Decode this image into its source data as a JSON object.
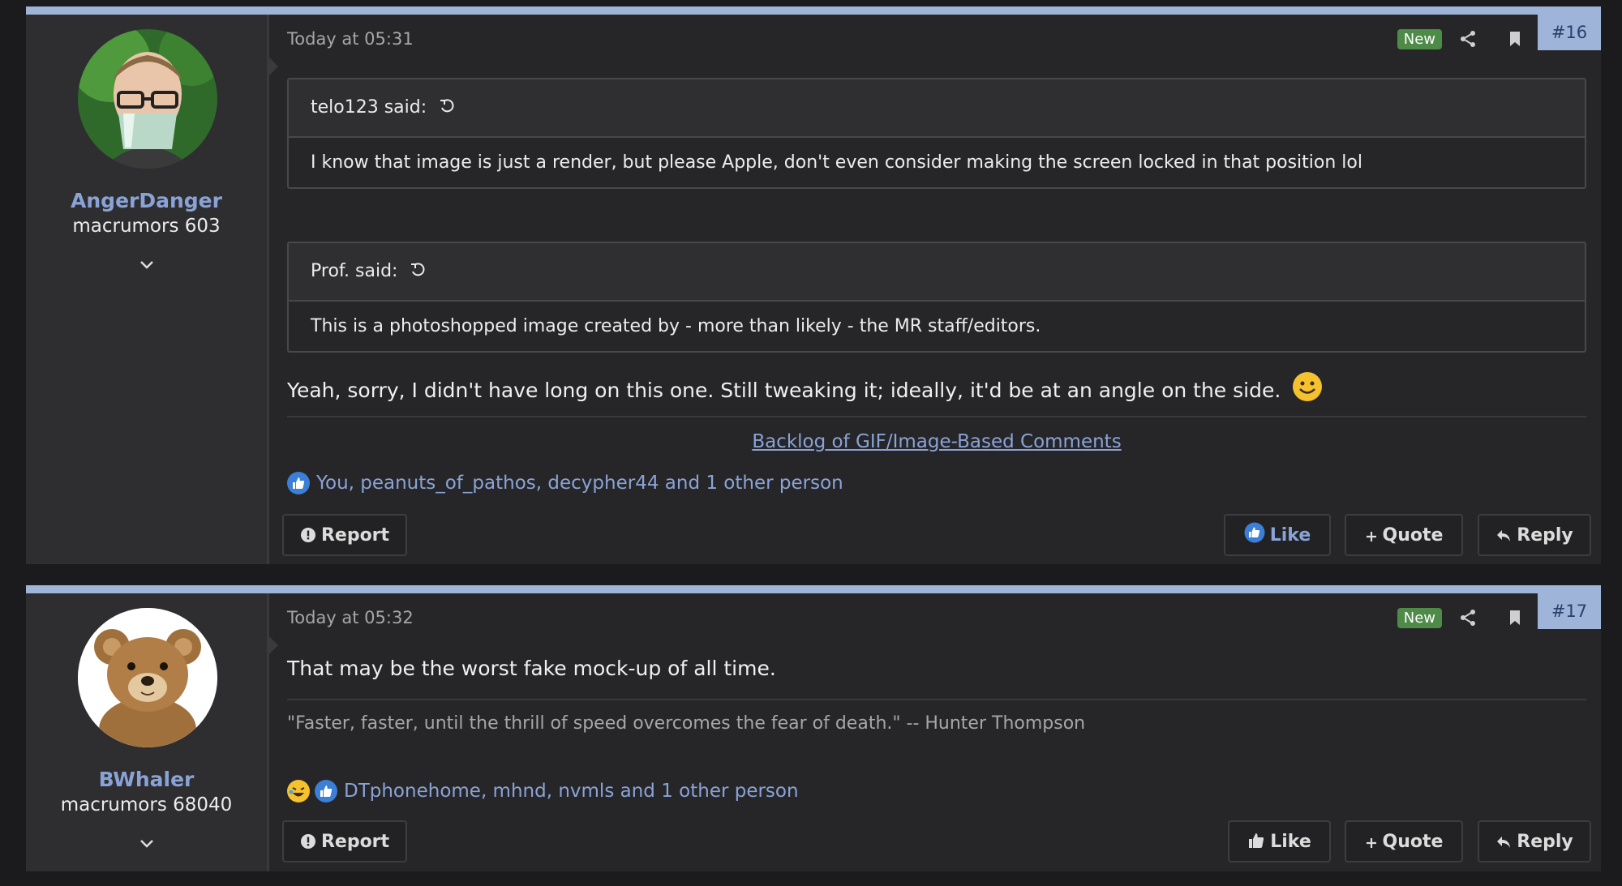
{
  "colors": {
    "accent": "#9fb4d9",
    "link": "#8aa3d6",
    "new_badge": "#4e8a48",
    "background": "#1b1b1d"
  },
  "posts": [
    {
      "date": "Today at 05:31",
      "new_label": "New",
      "number": "#16",
      "user": {
        "name": "AngerDanger",
        "title": "macrumors 603",
        "avatar": "user-avatar-glasses-mask"
      },
      "quotes": [
        {
          "author_label": "telo123 said:",
          "body": "I know that image is just a render, but please Apple, don't even consider making the screen locked in that position lol"
        },
        {
          "author_label": "Prof. said:",
          "body": "This is a photoshopped image created by - more than likely - the MR staff/editors."
        }
      ],
      "message": "Yeah, sorry, I didn't have long on this one. Still tweaking it; ideally, it'd be at an angle on the side.",
      "message_emoji": "smile-emoji",
      "signature_link": "Backlog of GIF/Image-Based Comments",
      "reactions_text": "You, peanuts_of_pathos, decypher44 and 1 other person",
      "actions": {
        "report": "Report",
        "like": "Like",
        "quote": "Quote",
        "reply": "Reply"
      }
    },
    {
      "date": "Today at 05:32",
      "new_label": "New",
      "number": "#17",
      "user": {
        "name": "BWhaler",
        "title": "macrumors 68040",
        "avatar": "teddy-bear-avatar"
      },
      "message": "That may be the worst fake mock-up of all time.",
      "signature": "\"Faster, faster, until the thrill of speed overcomes the fear of death.\" -- Hunter Thompson",
      "reactions_text": "DTphonehome, mhnd, nvmls and 1 other person",
      "actions": {
        "report": "Report",
        "like": "Like",
        "quote": "Quote",
        "reply": "Reply"
      }
    }
  ]
}
